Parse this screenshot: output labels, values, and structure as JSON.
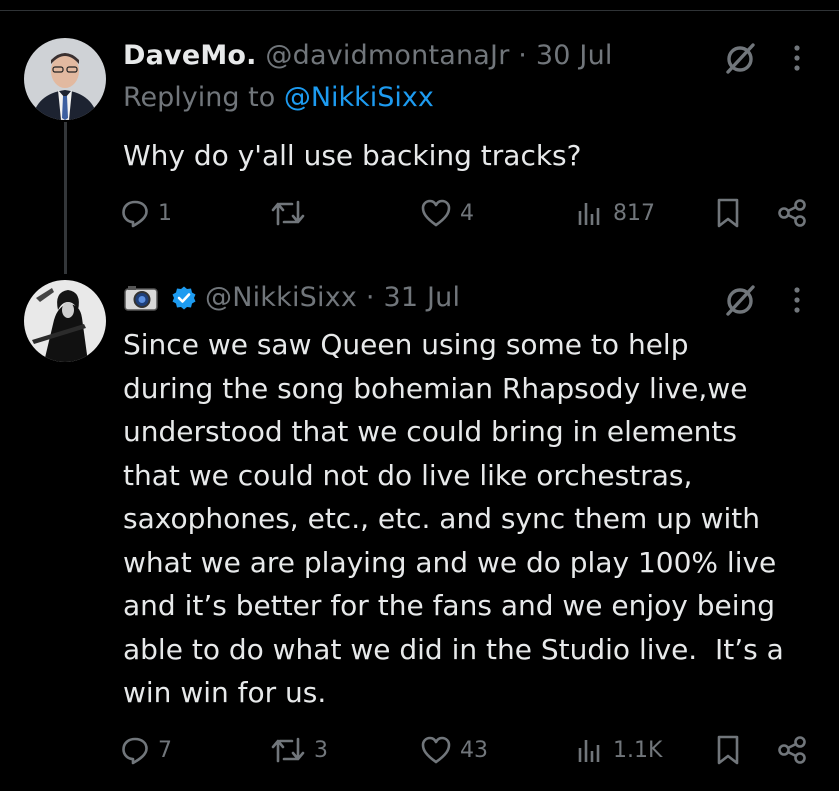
{
  "tweets": [
    {
      "display_name": "DaveMo.",
      "handle": "@davidmontanaJr",
      "separator": " · ",
      "date": "30 Jul",
      "replying_prefix": "Replying to ",
      "replying_to": "@NikkiSixx",
      "text": "Why do y'all use backing tracks?",
      "stats": {
        "replies": "1",
        "retweets": "",
        "likes": "4",
        "views": "817"
      }
    },
    {
      "display_name": "",
      "handle": "@NikkiSixx",
      "separator": " · ",
      "date": "31 Jul",
      "text": "Since we saw Queen using some to help\nduring the song bohemian Rhapsody live,we\nunderstood that we could bring in elements\nthat we could not do live like orchestras,\nsaxophones, etc., etc. and sync them up with\nwhat we are playing and we do play 100% live\nand it’s better for the fans and we enjoy being\nable to do what we did in the Studio live.  It’s a\nwin win for us.",
      "stats": {
        "replies": "7",
        "retweets": "3",
        "likes": "43",
        "views": "1.1K"
      }
    }
  ],
  "colors": {
    "background": "#000000",
    "text": "#e7e9ea",
    "muted": "#71767b",
    "link": "#1d9bf0",
    "verified": "#1d9bf0"
  },
  "icons": [
    "reply-icon",
    "retweet-icon",
    "like-icon",
    "views-icon",
    "bookmark-icon",
    "share-icon",
    "grok-icon",
    "more-icon",
    "verified-badge-icon",
    "camera-emoji-icon"
  ]
}
